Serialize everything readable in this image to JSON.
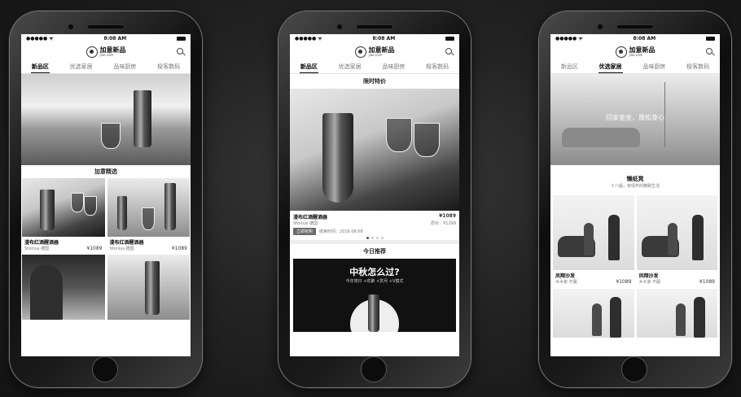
{
  "status": {
    "carrier": "●●●●● ᯤ",
    "time": "8:08 AM"
  },
  "brand": {
    "name": "加意新品",
    "sub": "jiae.com"
  },
  "tabs": [
    "新品区",
    "优选家居",
    "品味厨房",
    "极客数码"
  ],
  "phone1": {
    "section": "加意精选",
    "items": [
      {
        "name": "漫布红酒醒酒器",
        "brand": "Stonius·德国",
        "price": "¥1089"
      },
      {
        "name": "漫布红酒醒酒器",
        "brand": "Stonius·德国",
        "price": "¥1089"
      }
    ]
  },
  "phone2": {
    "section": "限时特价",
    "product": {
      "name": "漫布红酒醒酒器",
      "brand": "Stonius·德国",
      "price": "¥1089",
      "original": "原价：¥1299",
      "button": "立即抢购",
      "deadline": "结束时间：2016.08.08"
    },
    "today": "今日推荐",
    "banner": {
      "title": "中秋怎么过?",
      "sub": "今年将日 +欢聚 +赏月 +V模式"
    }
  },
  "phone3": {
    "banner_text": "回家坐坐，放松身心",
    "section": "懒纸凳",
    "sub": "十八般，有情怀的精致生活",
    "items": [
      {
        "name": "凤翔沙发",
        "brand": "木木家·不服",
        "price": "¥1089"
      },
      {
        "name": "凤翔沙发",
        "brand": "木木家·不服",
        "price": "¥1089"
      }
    ]
  },
  "colors": {
    "accent": "#000000",
    "bg": "#1c1c1c"
  }
}
